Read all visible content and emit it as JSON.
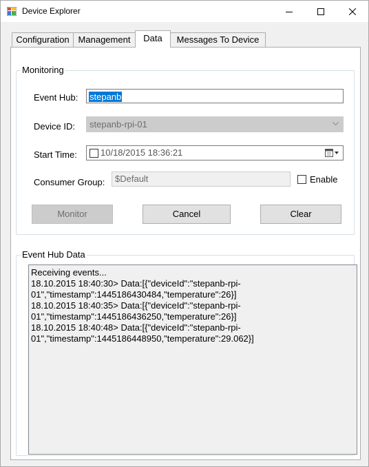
{
  "window": {
    "title": "Device Explorer",
    "app_icon": "app-icon"
  },
  "tabs": [
    {
      "label": "Configuration",
      "active": false
    },
    {
      "label": "Management",
      "active": false
    },
    {
      "label": "Data",
      "active": true
    },
    {
      "label": "Messages To Device",
      "active": false
    }
  ],
  "monitoring": {
    "legend": "Monitoring",
    "event_hub": {
      "label": "Event Hub:",
      "value": "stepanb"
    },
    "device_id": {
      "label": "Device ID:",
      "value": "stepanb-rpi-01"
    },
    "start_time": {
      "label": "Start Time:",
      "value": "10/18/2015 18:36:21",
      "checked": false
    },
    "consumer_group": {
      "label": "Consumer Group:",
      "value": "$Default",
      "enable_label": "Enable",
      "enable_checked": false
    },
    "buttons": {
      "monitor": "Monitor",
      "cancel": "Cancel",
      "clear": "Clear"
    }
  },
  "event_hub_data": {
    "legend": "Event Hub Data",
    "lines": [
      "Receiving events...",
      "18.10.2015 18:40:30> Data:[{\"deviceId\":\"stepanb-rpi-",
      "01\",\"timestamp\":1445186430484,\"temperature\":26}]",
      "18.10.2015 18:40:35> Data:[{\"deviceId\":\"stepanb-rpi-",
      "01\",\"timestamp\":1445186436250,\"temperature\":26}]",
      "18.10.2015 18:40:48> Data:[{\"deviceId\":\"stepanb-rpi-",
      "01\",\"timestamp\":1445186448950,\"temperature\":29.062}]"
    ]
  },
  "icons": {
    "minimize": "minimize-icon",
    "maximize": "maximize-icon",
    "close": "close-icon",
    "dropdown": "chevron-down-icon",
    "calendar": "calendar-icon"
  },
  "colors": {
    "selection": "#0078d7",
    "window_bg": "#f0f0f0",
    "disabled": "#cccccc"
  }
}
